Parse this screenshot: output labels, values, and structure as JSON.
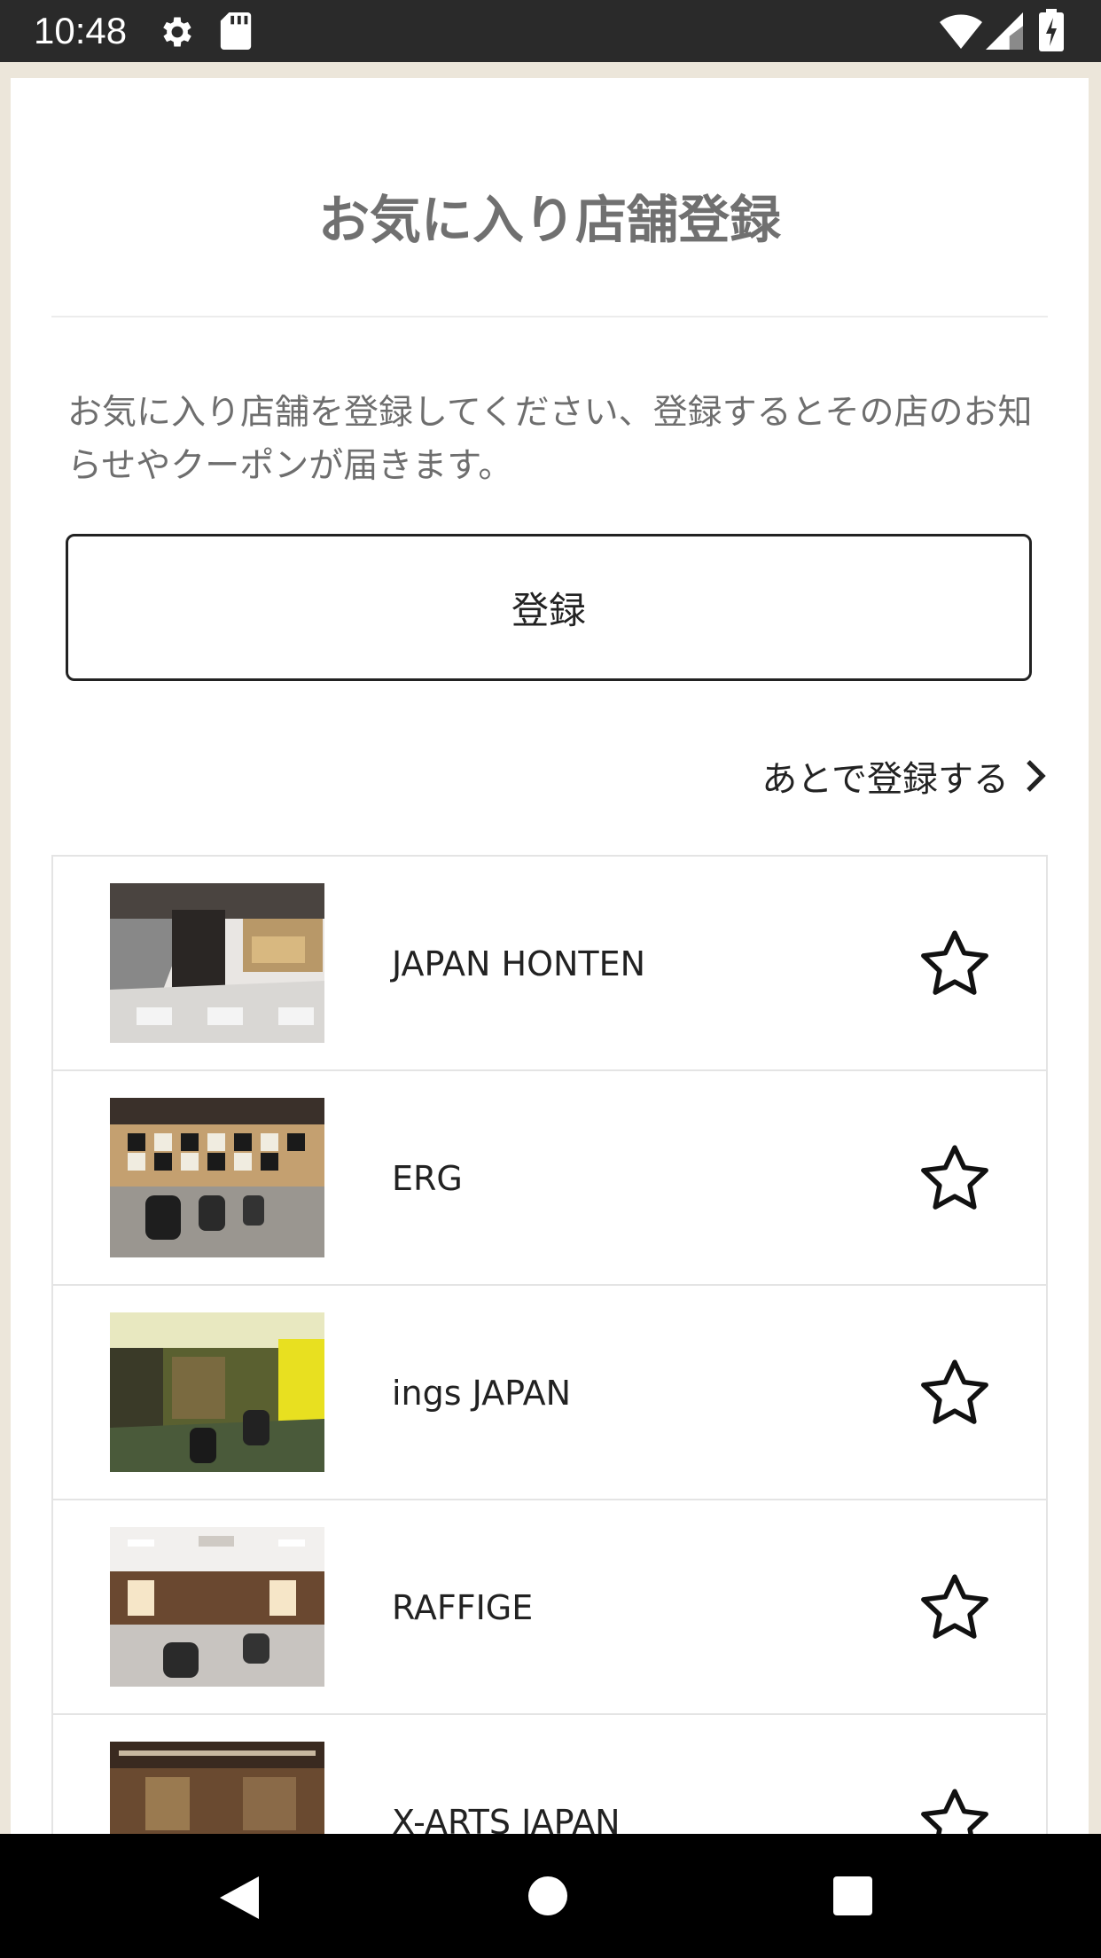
{
  "status_bar": {
    "time": "10:48",
    "icons": [
      "gear-icon",
      "sd-card-icon",
      "wifi-icon",
      "signal-icon",
      "battery-icon"
    ]
  },
  "page": {
    "title": "お気に入り店舗登録",
    "description": "お気に入り店舗を登録してください、登録するとその店のお知らせやクーポンが届きます。",
    "register_button_label": "登録",
    "later_link_label": "あとで登録する"
  },
  "stores": [
    {
      "name": "JAPAN HONTEN",
      "favorited": false
    },
    {
      "name": "ERG",
      "favorited": false
    },
    {
      "name": "ings JAPAN",
      "favorited": false
    },
    {
      "name": "RAFFIGE",
      "favorited": false
    },
    {
      "name": "X-ARTS JAPAN",
      "favorited": false
    }
  ],
  "nav_bar": {
    "icons": [
      "back-icon",
      "home-icon",
      "recents-icon"
    ]
  },
  "colors": {
    "status_bar": "#2a2a2a",
    "page_background": "#ece6da",
    "card": "#ffffff",
    "title_text": "#707070",
    "body_text": "#222222",
    "divider": "#e4e4e4"
  }
}
